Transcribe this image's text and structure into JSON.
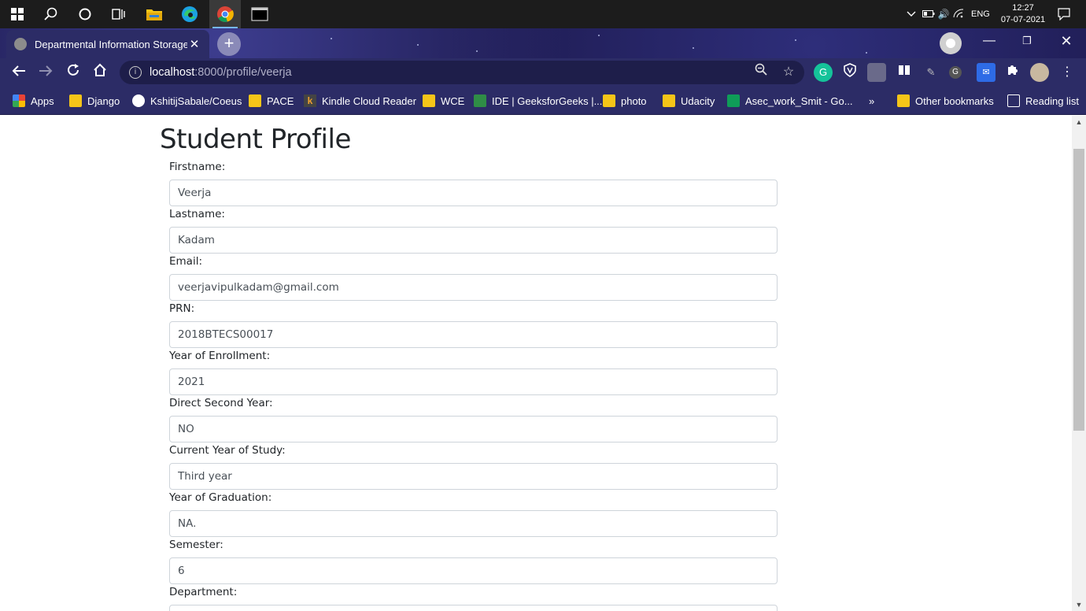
{
  "taskbar": {
    "icons": [
      "windows-start-icon",
      "search-icon",
      "cortana-icon",
      "task-view-icon",
      "file-explorer-icon",
      "edge-icon",
      "chrome-icon",
      "terminal-icon"
    ],
    "tray": {
      "language": "ENG",
      "time": "12:27",
      "date": "07-07-2021"
    }
  },
  "browser": {
    "tab_title": "Departmental Information Storage a",
    "url_host": "localhost",
    "url_path": ":8000/profile/veerja",
    "bookmarks": [
      "Apps",
      "Django",
      "KshitijSabale/Coeus",
      "PACE",
      "Kindle Cloud Reader",
      "WCE",
      "IDE | GeeksforGeeks |...",
      "photo",
      "Udacity",
      "Asec_work_Smit - Go...",
      "»",
      "Other bookmarks",
      "Reading list"
    ]
  },
  "page": {
    "title": "Student Profile",
    "fields": [
      {
        "label": "Firstname:",
        "value": "Veerja"
      },
      {
        "label": "Lastname:",
        "value": "Kadam"
      },
      {
        "label": "Email:",
        "value": "veerjavipulkadam@gmail.com"
      },
      {
        "label": "PRN:",
        "value": "2018BTECS00017"
      },
      {
        "label": "Year of Enrollment:",
        "value": "2021"
      },
      {
        "label": "Direct Second Year:",
        "value": "NO"
      },
      {
        "label": "Current Year of Study:",
        "value": "Third year"
      },
      {
        "label": "Year of Graduation:",
        "value": "NA."
      },
      {
        "label": "Semester:",
        "value": "6"
      },
      {
        "label": "Department:",
        "value": ""
      }
    ]
  }
}
